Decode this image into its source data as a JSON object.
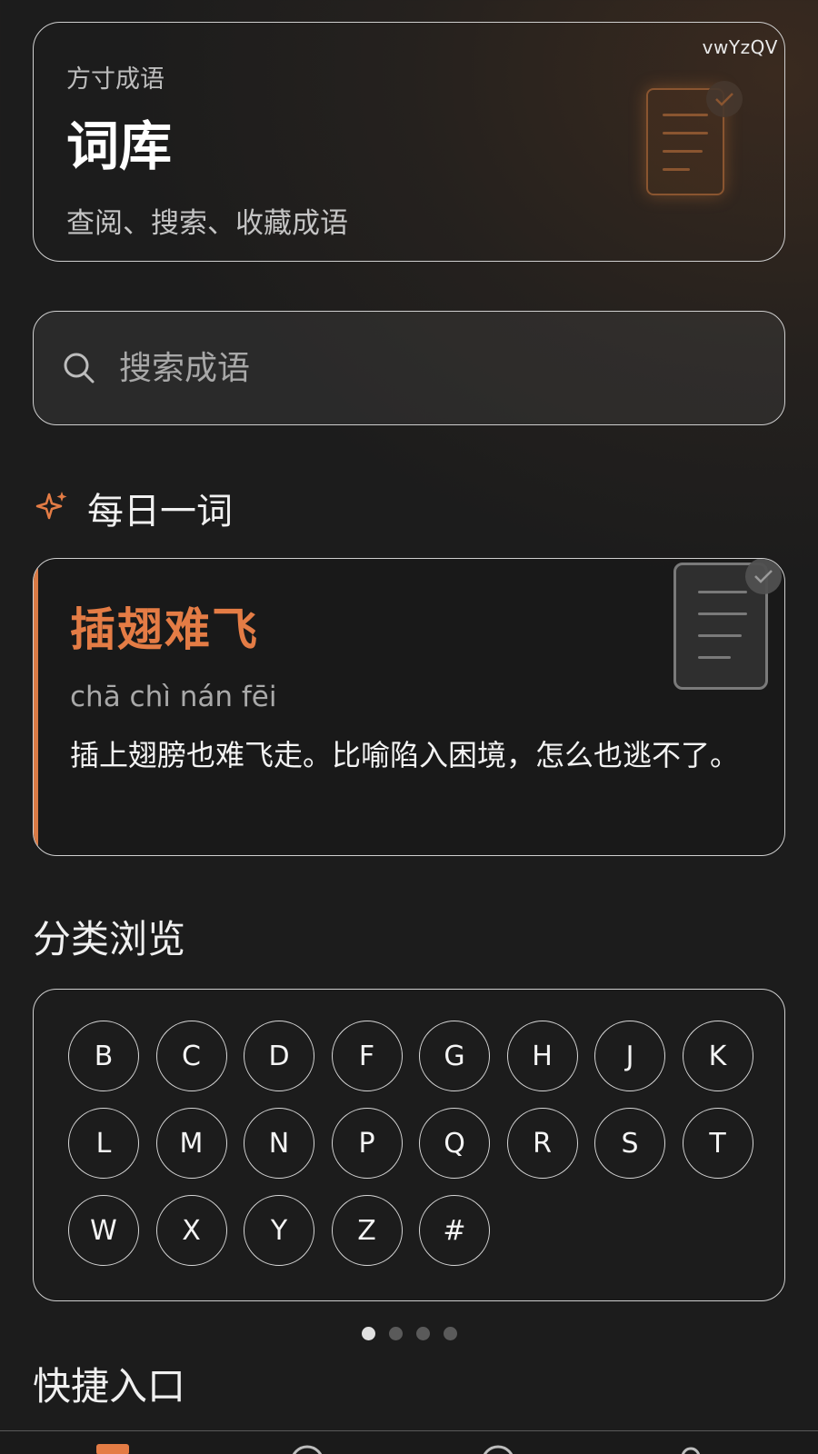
{
  "watermark": "vwYzQV",
  "header": {
    "subtitle": "方寸成语",
    "title": "词库",
    "description": "查阅、搜索、收藏成语"
  },
  "search": {
    "placeholder": "搜索成语"
  },
  "daily": {
    "section_title": "每日一词",
    "word": "插翅难飞",
    "pinyin": "chā chì nán fēi",
    "meaning": "插上翅膀也难飞走。比喻陷入困境，怎么也逃不了。"
  },
  "categories": {
    "section_title": "分类浏览",
    "letters": [
      "B",
      "C",
      "D",
      "F",
      "G",
      "H",
      "J",
      "K",
      "L",
      "M",
      "N",
      "P",
      "Q",
      "R",
      "S",
      "T",
      "W",
      "X",
      "Y",
      "Z",
      "#"
    ]
  },
  "pagination": {
    "active_index": 0,
    "count": 4
  },
  "quick": {
    "section_title": "快捷入口"
  },
  "icons": {
    "search": "search-icon",
    "daily": "sparkle-icon",
    "document": "document-check-icon"
  },
  "colors": {
    "accent": "#e47c45",
    "accent_dark": "#8a5530",
    "border": "#cfcfcf",
    "background": "#1e1e1e"
  }
}
